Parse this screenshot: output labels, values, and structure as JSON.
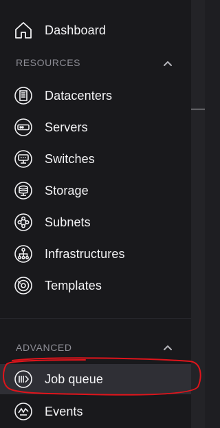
{
  "nav": {
    "dashboard": {
      "label": "Dashboard",
      "icon": "home-icon"
    },
    "resources": {
      "title": "RESOURCES",
      "expanded": true,
      "items": [
        {
          "label": "Datacenters",
          "icon": "datacenter-icon"
        },
        {
          "label": "Servers",
          "icon": "server-icon"
        },
        {
          "label": "Switches",
          "icon": "switch-icon"
        },
        {
          "label": "Storage",
          "icon": "storage-icon"
        },
        {
          "label": "Subnets",
          "icon": "subnet-icon"
        },
        {
          "label": "Infrastructures",
          "icon": "infrastructure-icon"
        },
        {
          "label": "Templates",
          "icon": "template-icon"
        }
      ]
    },
    "advanced": {
      "title": "ADVANCED",
      "expanded": true,
      "items": [
        {
          "label": "Job queue",
          "icon": "job-queue-icon",
          "active": true
        },
        {
          "label": "Events",
          "icon": "events-icon"
        }
      ]
    }
  },
  "colors": {
    "sidebar_bg": "#19191c",
    "active_bg": "#2f2f35",
    "section_text": "#8e8e96",
    "annotation": "#e0141b"
  }
}
